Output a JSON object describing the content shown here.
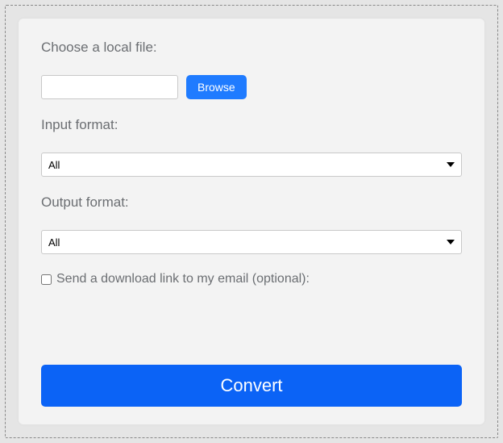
{
  "labels": {
    "choose_file": "Choose a local file:",
    "input_format": "Input format:",
    "output_format": "Output format:",
    "email_option": "Send a download link to my email (optional):"
  },
  "buttons": {
    "browse": "Browse",
    "convert": "Convert"
  },
  "file_input": {
    "value": ""
  },
  "input_format_select": {
    "selected": "All",
    "options": [
      "All"
    ]
  },
  "output_format_select": {
    "selected": "All",
    "options": [
      "All"
    ]
  },
  "email_checkbox": {
    "checked": false
  }
}
